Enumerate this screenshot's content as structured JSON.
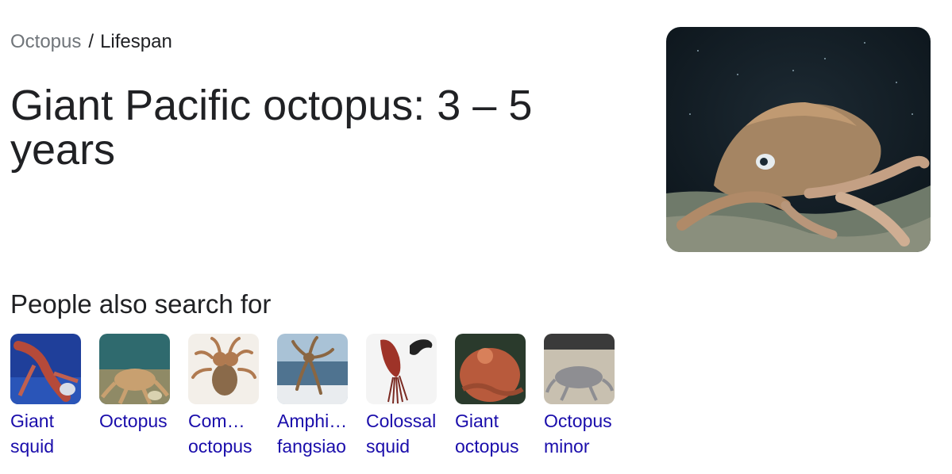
{
  "breadcrumb": {
    "parent": "Octopus",
    "separator": "/",
    "current": "Lifespan"
  },
  "answer": {
    "title": "Giant Pacific octopus: 3 – 5 years"
  },
  "people_also_search": {
    "heading": "People also search for",
    "items": [
      {
        "line1": "Giant",
        "line2": "squid"
      },
      {
        "line1": "Octopus",
        "line2": ""
      },
      {
        "line1": "Common",
        "line2": "octopus"
      },
      {
        "line1": "Amphioctopus",
        "line2": "fangsiao"
      },
      {
        "line1": "Colossal",
        "line2": "squid"
      },
      {
        "line1": "Giant",
        "line2": "octopus"
      },
      {
        "line1": "Octopus",
        "line2": "minor"
      }
    ]
  },
  "colors": {
    "link": "#1a0dab",
    "text": "#202124",
    "muted": "#70757a"
  }
}
